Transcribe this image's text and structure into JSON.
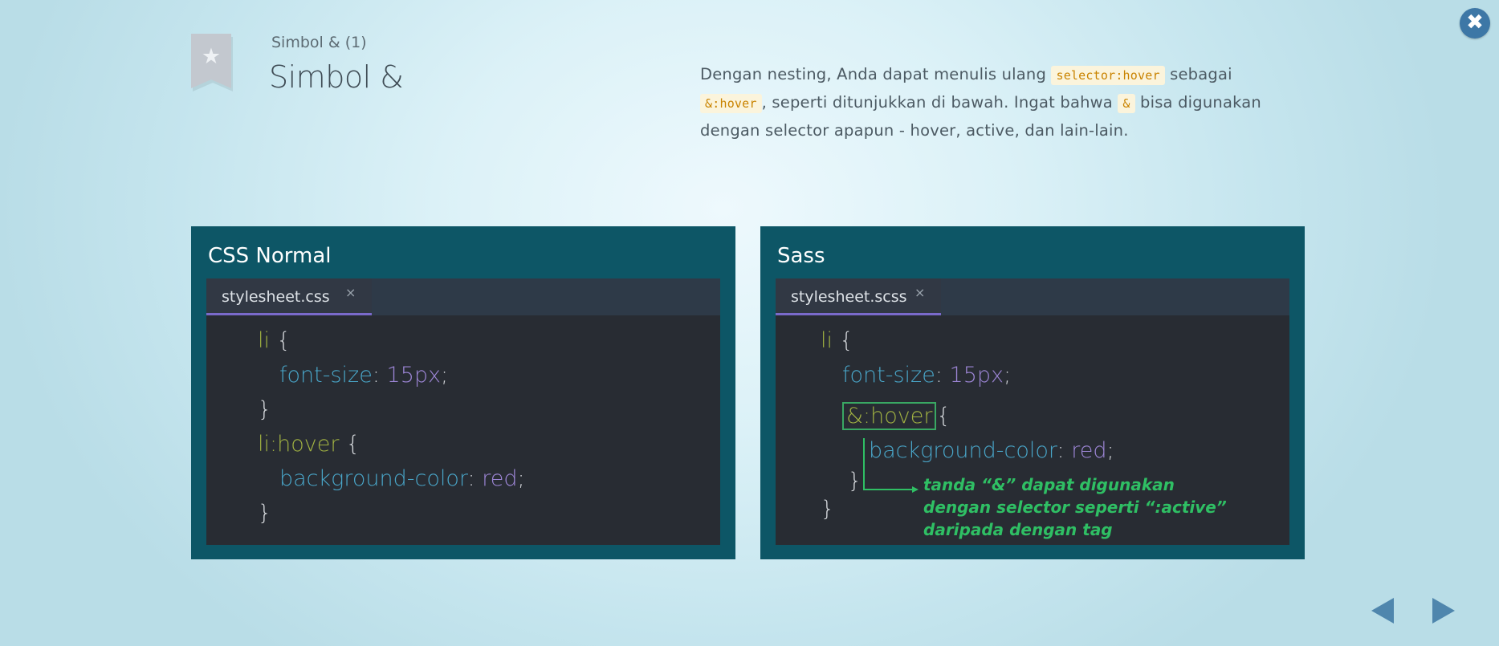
{
  "header": {
    "subtitle": "Simbol & (1)",
    "title": "Simbol &"
  },
  "description": {
    "p1": "Dengan nesting, Anda dapat menulis ulang ",
    "code1": "selector:hover",
    "p2": " sebagai",
    "code2": "&:hover",
    "p3": ", seperti ditunjukkan di bawah. Ingat bahwa ",
    "code3": "&",
    "p4": " bisa digunakan dengan selector apapun - hover, active, dan lain-lain."
  },
  "close": {
    "label": "✖"
  },
  "left_panel": {
    "title": "CSS Normal",
    "tab": {
      "label": "stylesheet.css",
      "close": "×"
    },
    "code": {
      "l1_sel": "li",
      "l1_brace": " {",
      "l2_prop": "font-size",
      "l2_colon": ": ",
      "l2_val": "15px",
      "l2_semi": ";",
      "l3": "}",
      "l4_sel": "li:hover",
      "l4_brace": " {",
      "l5_prop": "background-color",
      "l5_colon": ": ",
      "l5_val": "red",
      "l5_semi": ";",
      "l6": "}"
    }
  },
  "right_panel": {
    "title": "Sass",
    "tab": {
      "label": "stylesheet.scss",
      "close": "×"
    },
    "code": {
      "l1_sel": "li",
      "l1_brace": " {",
      "l2_prop": "font-size",
      "l2_colon": ": ",
      "l2_val": "15px",
      "l2_semi": ";",
      "l3_sel": "&:hover",
      "l3_brace": "{",
      "l4_prop": "background-color",
      "l4_colon": ": ",
      "l4_val": "red",
      "l4_semi": ";",
      "l5": "}",
      "l6": "}"
    },
    "annotation": "tanda “&” dapat digunakan dengan selector seperti “:active” daripada dengan tag"
  },
  "colors": {
    "panel_bg": "#0d5666",
    "editor_bg": "#282c33",
    "tab_underline": "#7a6acb",
    "annotation": "#2fbf64",
    "nav_arrow": "#4f86ad",
    "close_button": "#3d77a6"
  },
  "icons": {
    "bookmark": "bookmark-star-icon",
    "close": "close-circle-icon",
    "prev": "arrow-left-icon",
    "next": "arrow-right-icon"
  }
}
